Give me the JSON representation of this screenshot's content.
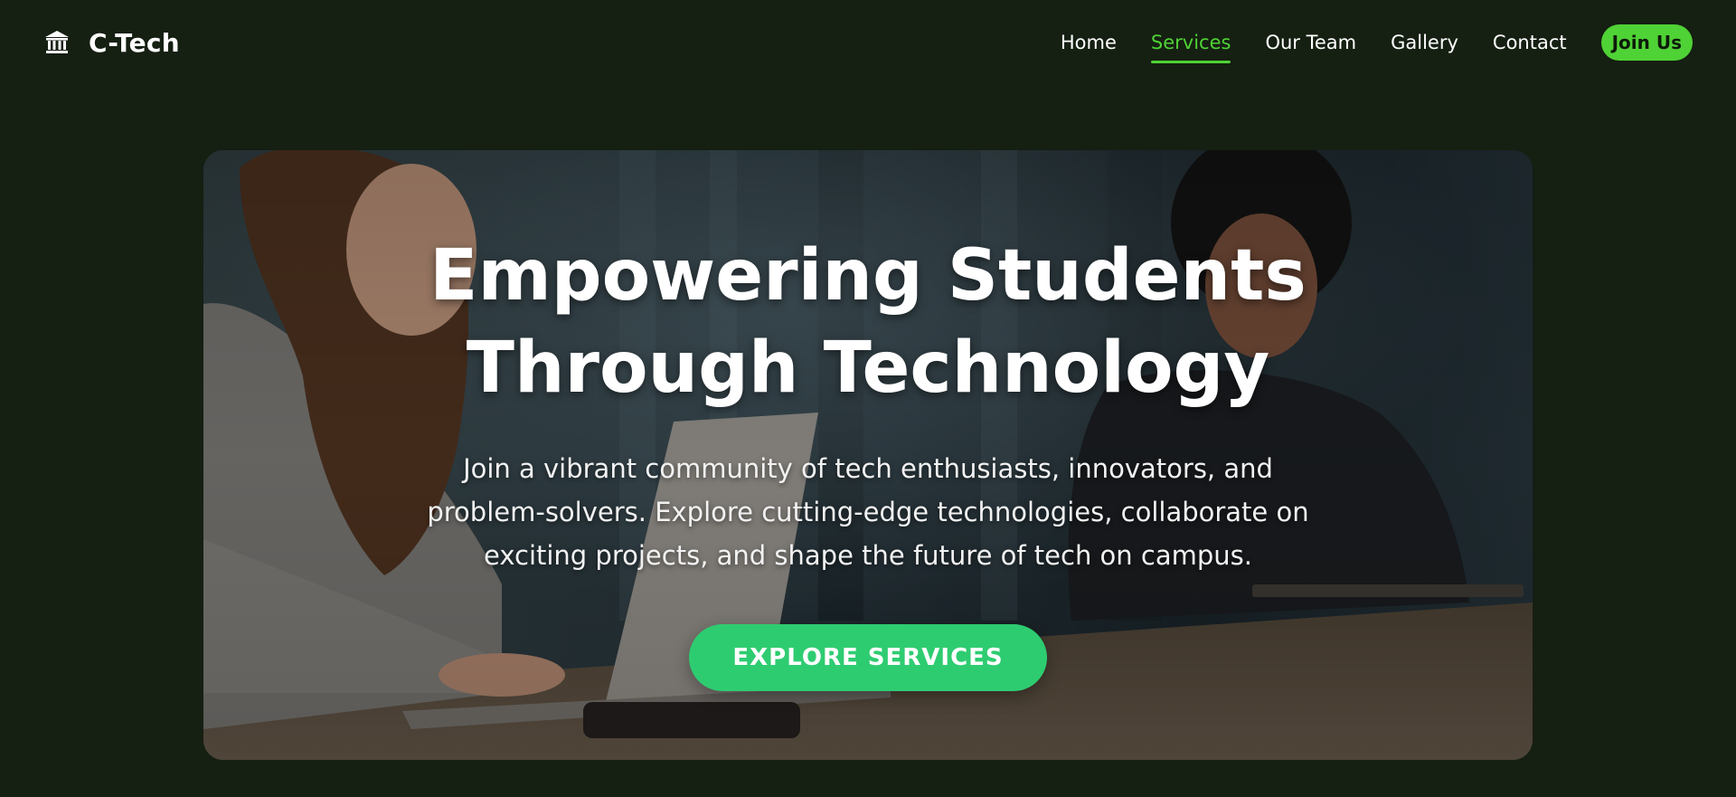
{
  "brand": {
    "name": "C-Tech",
    "icon": "institution-icon"
  },
  "nav": {
    "items": [
      {
        "label": "Home",
        "active": false
      },
      {
        "label": "Services",
        "active": true
      },
      {
        "label": "Our Team",
        "active": false
      },
      {
        "label": "Gallery",
        "active": false
      },
      {
        "label": "Contact",
        "active": false
      }
    ],
    "join_label": "Join Us"
  },
  "hero": {
    "title_line1": "Empowering Students",
    "title_line2": "Through Technology",
    "subtitle": "Join a vibrant community of tech enthusiasts, innovators, and problem-solvers. Explore cutting-edge technologies, collaborate on exciting projects, and shape the future of tech on campus.",
    "cta_label": "EXPLORE SERVICES"
  },
  "colors": {
    "background": "#151f12",
    "accent": "#4fd235",
    "cta": "#2ecc71"
  }
}
